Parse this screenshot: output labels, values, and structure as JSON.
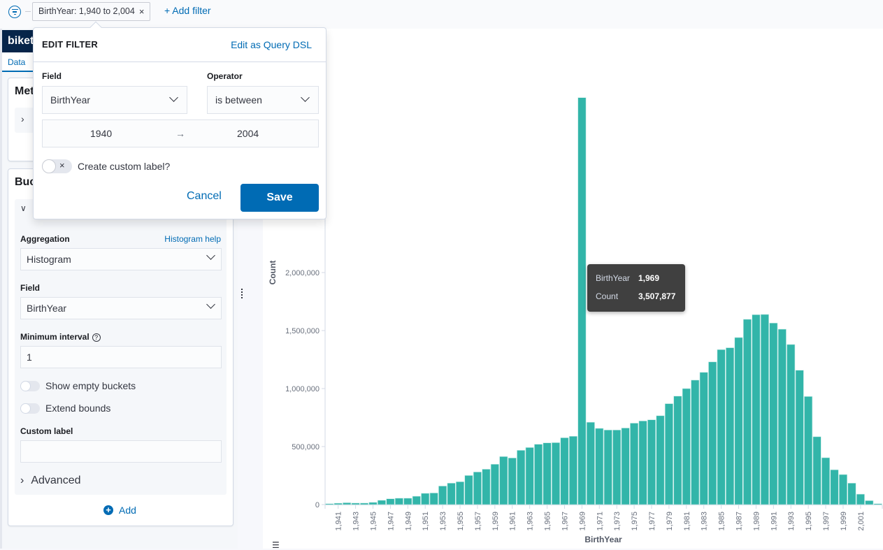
{
  "filter_bar": {
    "filter_pill_label": "BirthYear: 1,940 to 2,004",
    "remove_icon": "×",
    "add_filter_label": "+ Add filter"
  },
  "sidebar": {
    "index_name": "biket",
    "tab_data": "Data",
    "metrics_title": "Met",
    "buckets_title": "Buc",
    "aggregation_label": "Aggregation",
    "aggregation_help": "Histogram help",
    "aggregation_value": "Histogram",
    "field_label": "Field",
    "field_value": "BirthYear",
    "min_interval_label": "Minimum interval",
    "min_interval_value": "1",
    "show_empty_buckets": "Show empty buckets",
    "extend_bounds": "Extend bounds",
    "custom_label": "Custom label",
    "custom_label_value": "",
    "advanced": "Advanced",
    "add": "Add"
  },
  "edit_filter": {
    "title": "EDIT FILTER",
    "edit_dsl": "Edit as Query DSL",
    "field_label": "Field",
    "field_value": "BirthYear",
    "operator_label": "Operator",
    "operator_value": "is between",
    "range_from": "1940",
    "range_arrow": "→",
    "range_to": "2004",
    "custom_label_toggle": "Create custom label?",
    "cancel": "Cancel",
    "save": "Save"
  },
  "tooltip": {
    "key1": "BirthYear",
    "val1": "1,969",
    "key2": "Count",
    "val2": "3,507,877"
  },
  "colors": {
    "bar": "#32b5a9",
    "accent": "#006bb4"
  },
  "chart_data": {
    "type": "bar",
    "title": "",
    "xlabel": "BirthYear",
    "ylabel": "Count",
    "ylim": [
      0,
      2200000
    ],
    "yticks": [
      0,
      500000,
      1000000,
      1500000,
      2000000
    ],
    "ytick_labels": [
      "0",
      "500,000",
      "1,000,000",
      "1,500,000",
      "2,000,000"
    ],
    "xtick_labels": [
      "1,941",
      "1,943",
      "1,945",
      "1,947",
      "1,949",
      "1,951",
      "1,953",
      "1,955",
      "1,957",
      "1,959",
      "1,961",
      "1,963",
      "1,965",
      "1,967",
      "1,969",
      "1,971",
      "1,973",
      "1,975",
      "1,977",
      "1,979",
      "1,981",
      "1,983",
      "1,985",
      "1,987",
      "1,989",
      "1,991",
      "1,993",
      "1,995",
      "1,997",
      "1,999",
      "2,001"
    ],
    "xtick_values": [
      1941,
      1943,
      1945,
      1947,
      1949,
      1951,
      1953,
      1955,
      1957,
      1959,
      1961,
      1963,
      1965,
      1967,
      1969,
      1971,
      1973,
      1975,
      1977,
      1979,
      1981,
      1983,
      1985,
      1987,
      1989,
      1991,
      1993,
      1995,
      1997,
      1999,
      2001
    ],
    "categories": [
      1940,
      1941,
      1942,
      1943,
      1944,
      1945,
      1946,
      1947,
      1948,
      1949,
      1950,
      1951,
      1952,
      1953,
      1954,
      1955,
      1956,
      1957,
      1958,
      1959,
      1960,
      1961,
      1962,
      1963,
      1964,
      1965,
      1966,
      1967,
      1968,
      1969,
      1970,
      1971,
      1972,
      1973,
      1974,
      1975,
      1976,
      1977,
      1978,
      1979,
      1980,
      1981,
      1982,
      1983,
      1984,
      1985,
      1986,
      1987,
      1988,
      1989,
      1990,
      1991,
      1992,
      1993,
      1994,
      1995,
      1996,
      1997,
      1998,
      1999,
      2000,
      2001,
      2002,
      2003
    ],
    "values": [
      8000,
      12000,
      16000,
      13000,
      13000,
      19000,
      37000,
      50000,
      55000,
      55000,
      72000,
      97000,
      100000,
      160000,
      185000,
      197000,
      251000,
      281000,
      305000,
      348000,
      414000,
      402000,
      468000,
      492000,
      520000,
      532000,
      534000,
      576000,
      589000,
      3507877,
      710000,
      657000,
      643000,
      643000,
      660000,
      702000,
      721000,
      731000,
      766000,
      870000,
      935000,
      1000000,
      1073000,
      1140000,
      1230000,
      1336000,
      1352000,
      1440000,
      1597000,
      1637000,
      1639000,
      1565000,
      1512000,
      1380000,
      1158000,
      932000,
      585000,
      404000,
      300000,
      259000,
      185000,
      90000,
      34000,
      8000
    ],
    "grid": false,
    "legend": "none"
  }
}
